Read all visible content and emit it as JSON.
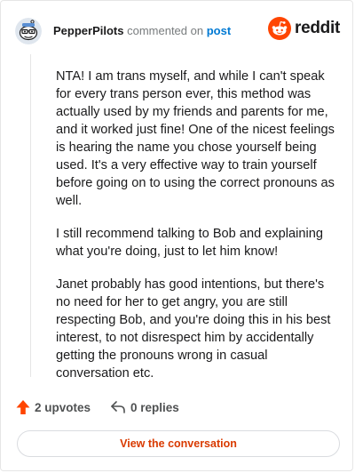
{
  "header": {
    "username": "PepperPilots",
    "action_text": "commented on",
    "post_link": "post",
    "brand": "reddit"
  },
  "comment": {
    "paragraphs": [
      "NTA! I am trans myself, and while I can't speak for every trans person ever, this method was actually used by my friends and parents for me, and it worked just fine! One of the nicest feelings is hearing the name you chose yourself being used. It's a very effective way to train yourself before going on to using the correct pronouns as well.",
      "I still recommend talking to Bob and explaining what you're doing, just to let him know!",
      "Janet probably has good intentions, but there's no need for her to get angry, you are still respecting Bob, and you're doing this in his best interest, to not disrespect him by accidentally getting the pronouns wrong in casual conversation etc."
    ]
  },
  "actions": {
    "upvotes": "2 upvotes",
    "replies": "0 replies"
  },
  "cta": {
    "label": "View the conversation"
  },
  "icons": {
    "avatar": "snoo-avatar",
    "brand": "reddit-alien-icon",
    "upvote": "upvote-arrow-icon",
    "reply": "reply-arrow-icon"
  },
  "colors": {
    "brand_orange": "#ff4500",
    "link_blue": "#0079d3",
    "cta_text": "#d93a00",
    "upvote": "#ff4500",
    "muted": "#787c7e"
  }
}
